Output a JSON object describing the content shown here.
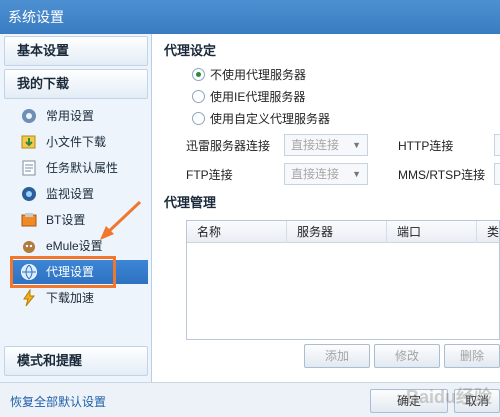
{
  "window": {
    "title": "系统设置"
  },
  "sidebar": {
    "group_basic": "基本设置",
    "group_download": "我的下载",
    "items": [
      {
        "label": "常用设置",
        "icon": "gear-icon"
      },
      {
        "label": "小文件下载",
        "icon": "small-file-download-icon"
      },
      {
        "label": "任务默认属性",
        "icon": "task-properties-icon"
      },
      {
        "label": "监视设置",
        "icon": "monitor-icon"
      },
      {
        "label": "BT设置",
        "icon": "bt-icon"
      },
      {
        "label": "eMule设置",
        "icon": "emule-icon"
      },
      {
        "label": "代理设置",
        "icon": "proxy-globe-icon",
        "selected": true
      },
      {
        "label": "下载加速",
        "icon": "lightning-icon"
      }
    ],
    "group_mode": "模式和提醒"
  },
  "proxy": {
    "section_title": "代理设定",
    "options": [
      {
        "label": "不使用代理服务器",
        "checked": true
      },
      {
        "label": "使用IE代理服务器",
        "checked": false
      },
      {
        "label": "使用自定义代理服务器",
        "checked": false
      }
    ],
    "xunlei_label": "迅雷服务器连接",
    "xunlei_value": "直接连接",
    "http_label": "HTTP连接",
    "ftp_label": "FTP连接",
    "ftp_value": "直接连接",
    "mms_label": "MMS/RTSP连接"
  },
  "management": {
    "section_title": "代理管理",
    "columns": [
      "名称",
      "服务器",
      "端口",
      "类"
    ],
    "buttons": {
      "add": "添加",
      "edit": "修改",
      "delete": "删除"
    }
  },
  "footer": {
    "reset_label": "恢复全部默认设置",
    "ok_label": "确定",
    "cancel_label": "取消"
  },
  "colors": {
    "titlebar": "#3a7cc1",
    "selected": "#2e72c1",
    "annotation": "#f0772c"
  },
  "watermark": "Baidu经验"
}
